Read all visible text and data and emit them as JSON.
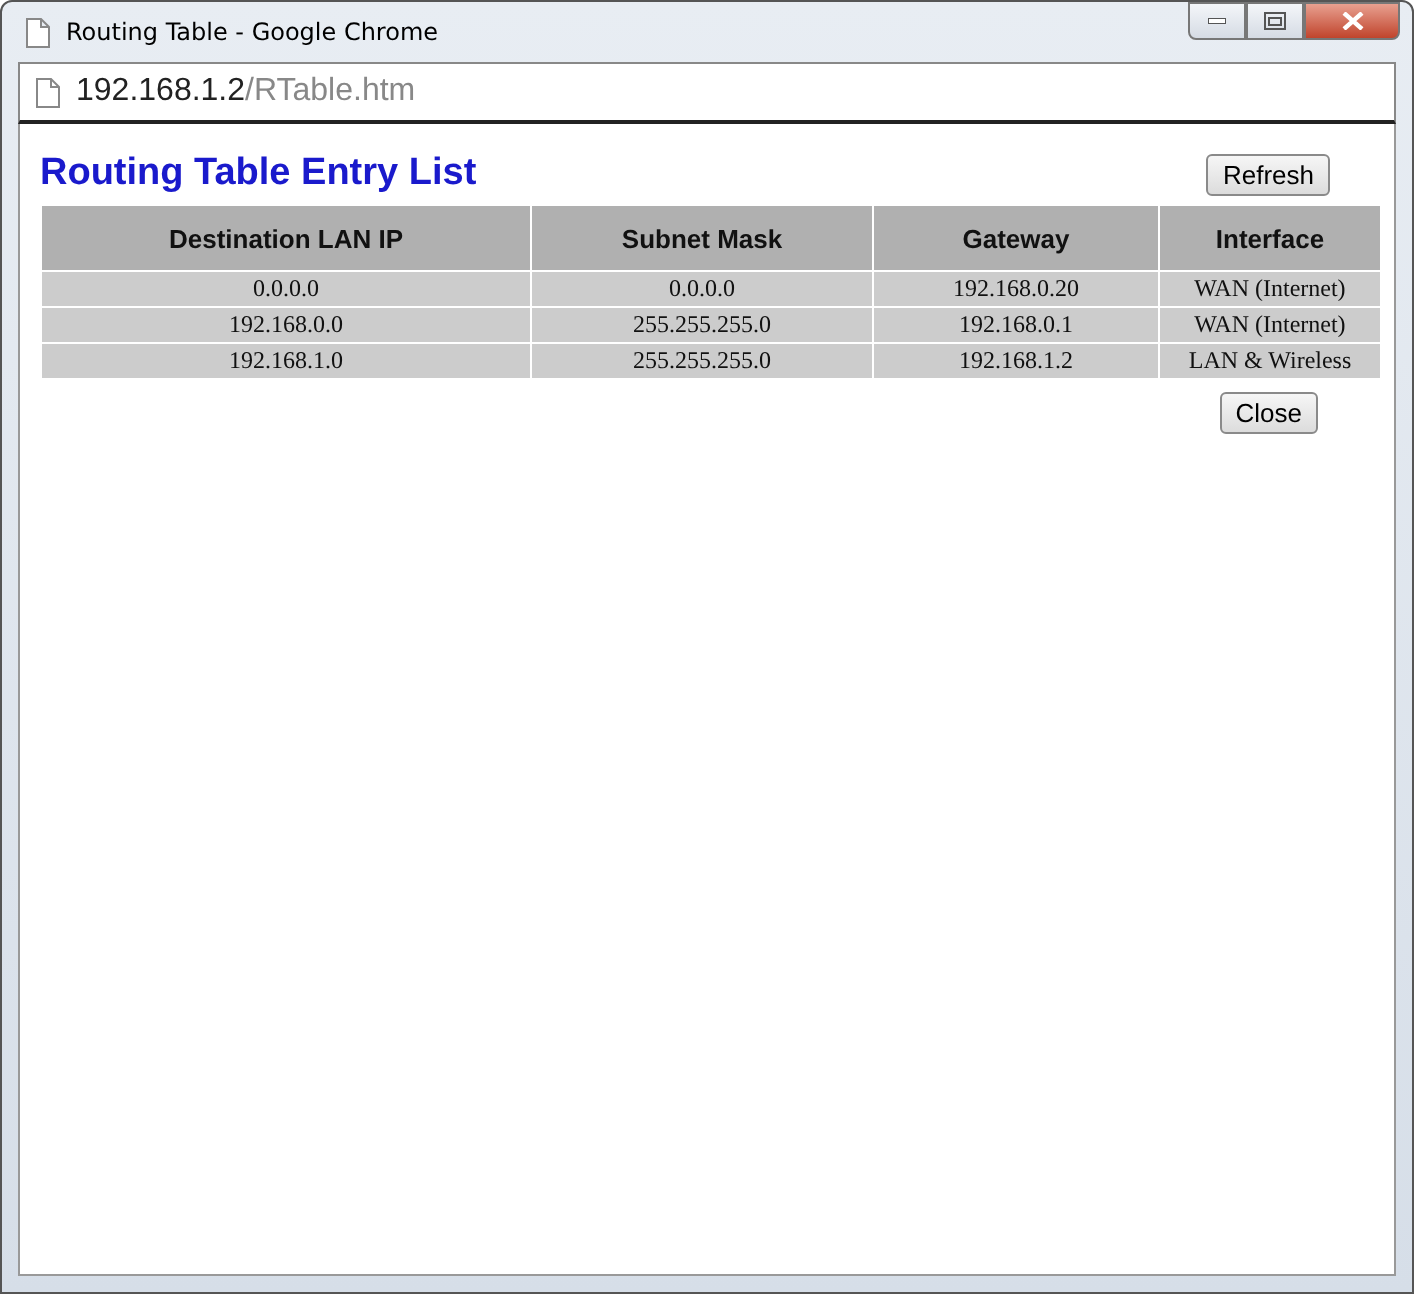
{
  "window": {
    "title": "Routing Table - Google Chrome"
  },
  "address": {
    "host": "192.168.1.2",
    "path": "/RTable.htm"
  },
  "page": {
    "heading": "Routing Table Entry List",
    "refresh_button": "Refresh",
    "close_button": "Close"
  },
  "table": {
    "columns": [
      "Destination LAN IP",
      "Subnet Mask",
      "Gateway",
      "Interface"
    ],
    "rows": [
      [
        "0.0.0.0",
        "0.0.0.0",
        "192.168.0.20",
        "WAN (Internet)"
      ],
      [
        "192.168.0.0",
        "255.255.255.0",
        "192.168.0.1",
        "WAN (Internet)"
      ],
      [
        "192.168.1.0",
        "255.255.255.0",
        "192.168.1.2",
        "LAN & Wireless"
      ]
    ]
  }
}
